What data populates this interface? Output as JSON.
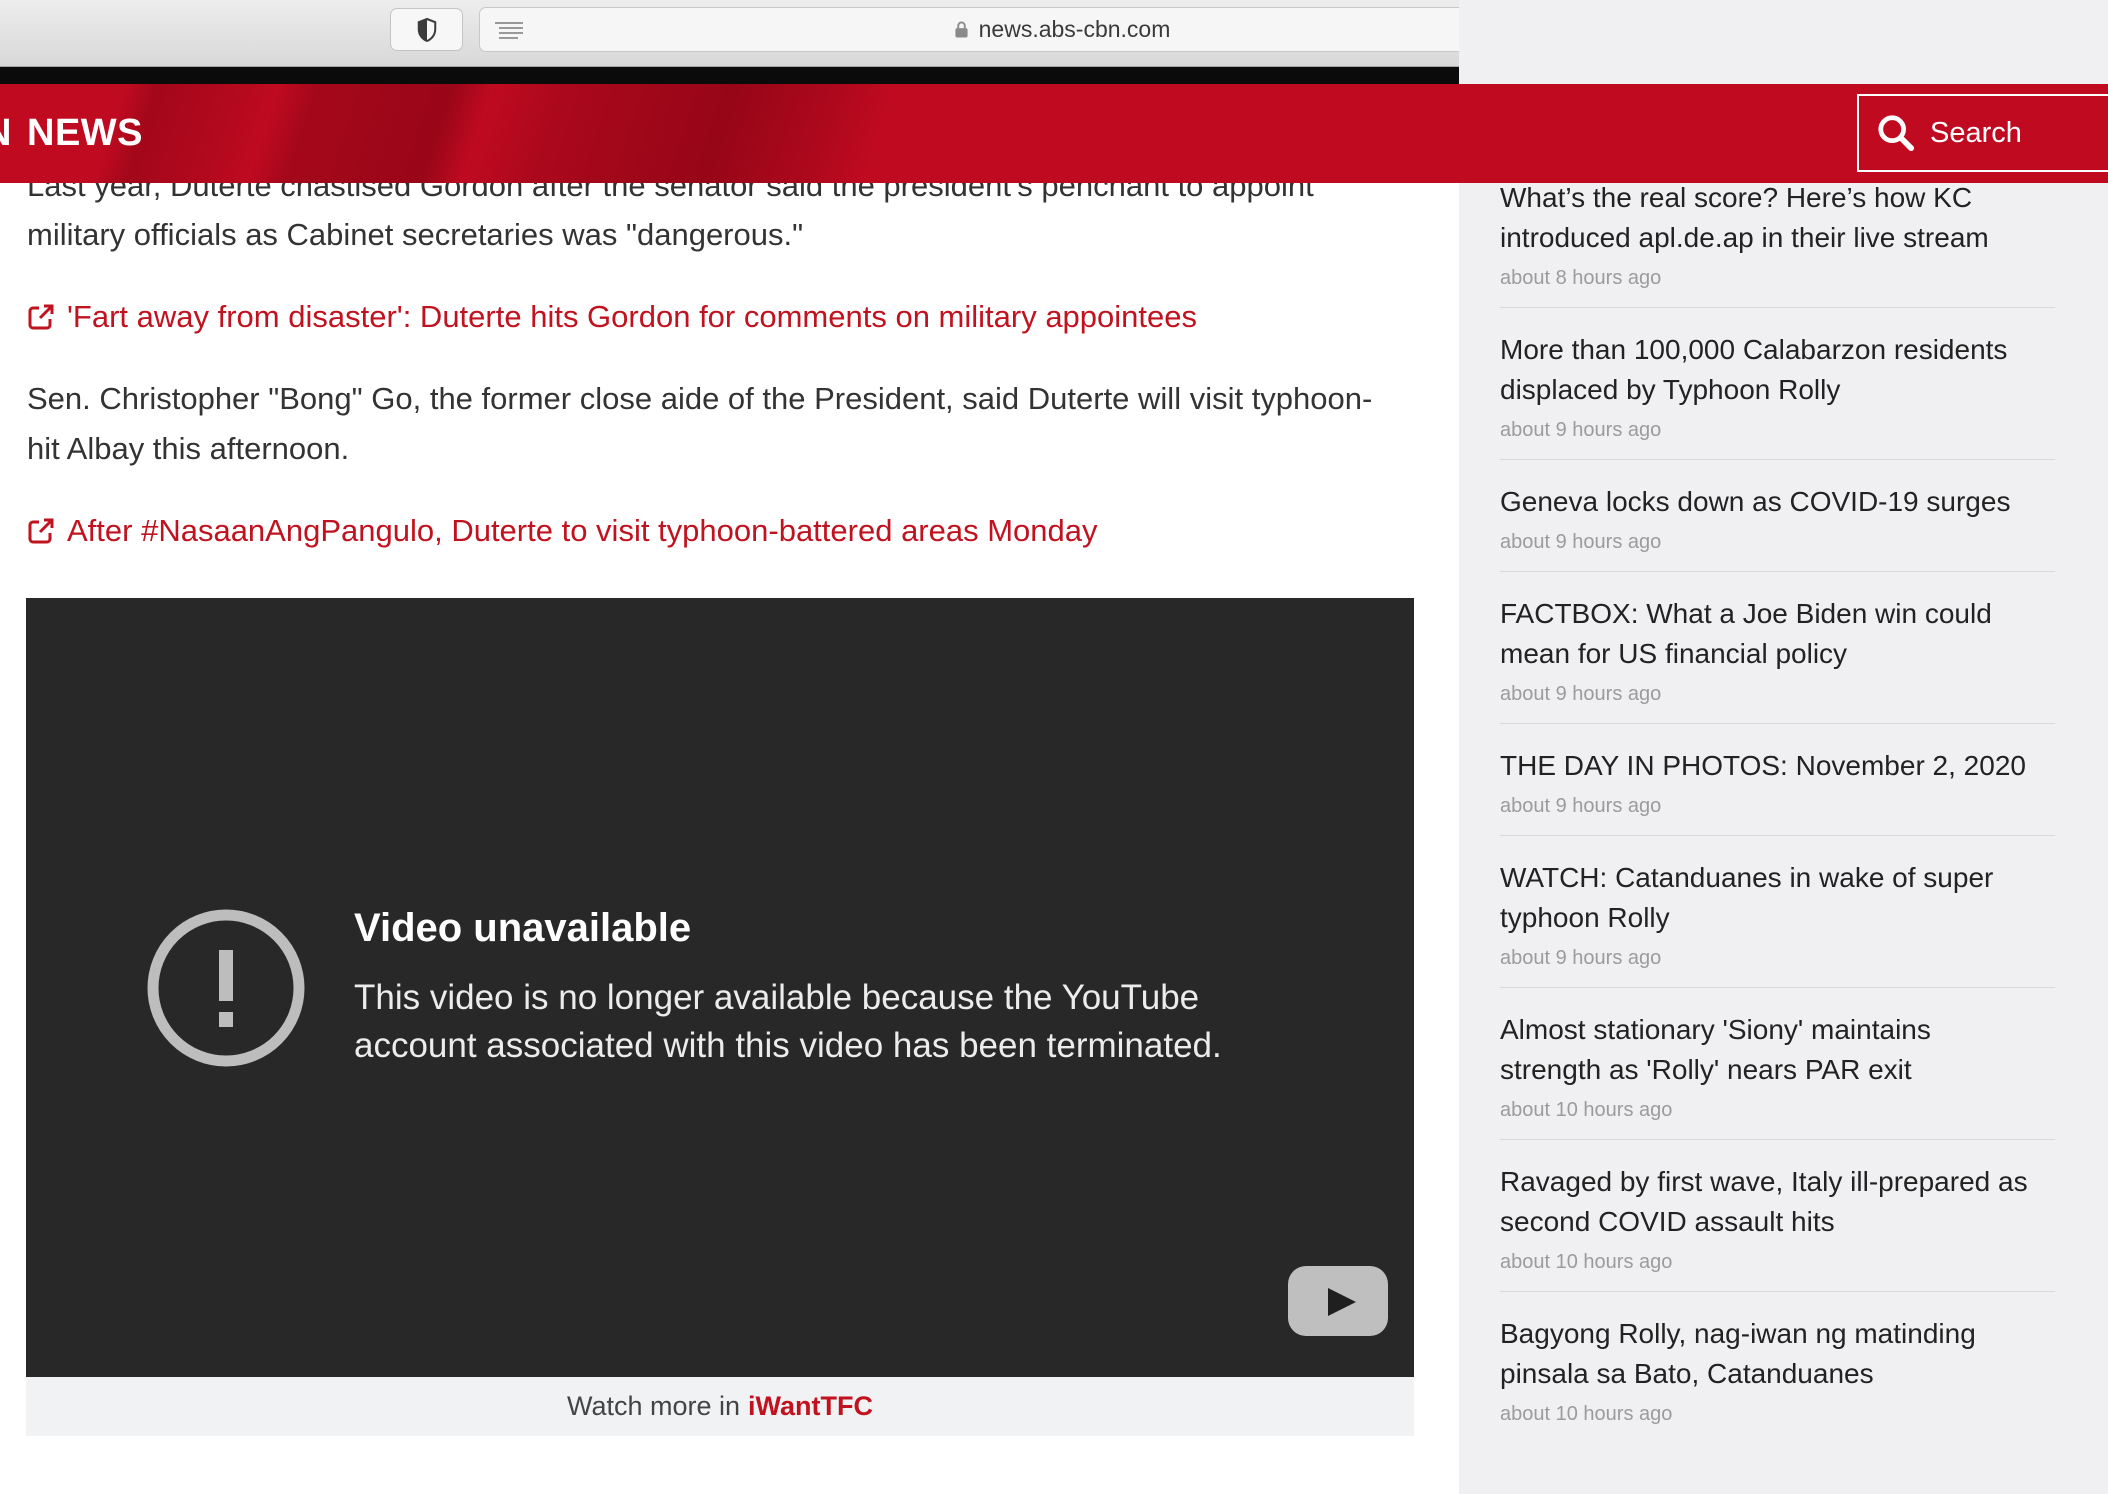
{
  "browser": {
    "url": "news.abs-cbn.com",
    "icons": {
      "privacy": "shield-icon",
      "reader": "reader-icon",
      "secure": "lock-icon",
      "reload": "reload-icon"
    }
  },
  "header": {
    "logo_fragment": "N",
    "logo_text": "NEWS",
    "search_label": "Search",
    "search_icon": "magnifier-icon"
  },
  "colors": {
    "brand_red": "#bf0a20",
    "link_red": "#c1121f",
    "video_bg": "#282828",
    "sidebar_bg": "#f0f0f2"
  },
  "article": {
    "paragraph_1_lines": [
      "Last year, Duterte chastised Gordon after the senator said the president’s penchant to appoint",
      "military officials as Cabinet secretaries was \"dangerous.\""
    ],
    "link_1": "'Fart away from disaster': Duterte hits Gordon for comments on military appointees",
    "paragraph_2_lines": [
      "Sen. Christopher \"Bong\" Go, the former close aide of the President, said Duterte will visit typhoon-",
      "hit Albay this afternoon."
    ],
    "link_2": "After #NasaanAngPangulo, Duterte to visit typhoon-battered areas Monday",
    "link_icon": "external-link-icon",
    "video": {
      "title": "Video unavailable",
      "message_lines": [
        "This video is no longer available because the YouTube",
        "account associated with this video has been terminated."
      ],
      "icons": {
        "warning": "exclamation-circle-icon",
        "logo": "youtube-logo-icon"
      }
    },
    "watch_more": {
      "prefix": "Watch more in",
      "brand": "iWantTFC"
    }
  },
  "sidebar": {
    "items": [
      {
        "title_lines": [
          "What’s the real score? Here’s how KC",
          "introduced apl.de.ap in their live stream"
        ],
        "time": "about 8 hours ago"
      },
      {
        "title_lines": [
          "More than 100,000 Calabarzon residents",
          "displaced by Typhoon Rolly"
        ],
        "time": "about 9 hours ago"
      },
      {
        "title_lines": [
          "Geneva locks down as COVID-19 surges"
        ],
        "time": "about 9 hours ago"
      },
      {
        "title_lines": [
          "FACTBOX: What a Joe Biden win could",
          "mean for US financial policy"
        ],
        "time": "about 9 hours ago"
      },
      {
        "title_lines": [
          "THE DAY IN PHOTOS: November 2, 2020"
        ],
        "time": "about 9 hours ago"
      },
      {
        "title_lines": [
          "WATCH: Catanduanes in wake of super",
          "typhoon Rolly"
        ],
        "time": "about 9 hours ago"
      },
      {
        "title_lines": [
          "Almost stationary 'Siony' maintains",
          "strength as 'Rolly' nears PAR exit"
        ],
        "time": "about 10 hours ago"
      },
      {
        "title_lines": [
          "Ravaged by first wave, Italy ill-prepared as",
          "second COVID assault hits"
        ],
        "time": "about 10 hours ago"
      },
      {
        "title_lines": [
          "Bagyong Rolly, nag-iwan ng matinding",
          "pinsala sa Bato, Catanduanes"
        ],
        "time": "about 10 hours ago"
      }
    ]
  }
}
